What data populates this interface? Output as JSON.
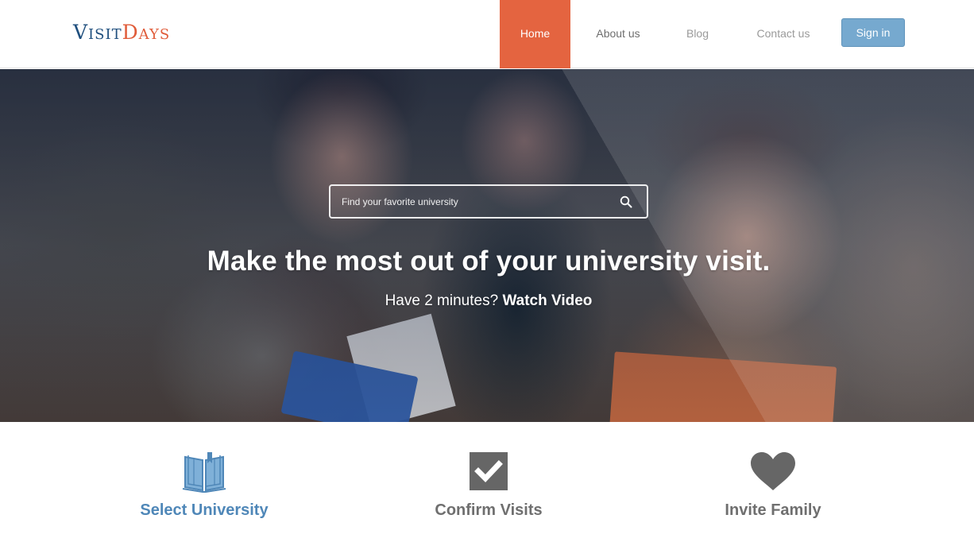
{
  "header": {
    "logo": {
      "part1": "Visit",
      "part2": "Days"
    },
    "nav": [
      {
        "label": "Home",
        "active": true
      },
      {
        "label": "About us"
      },
      {
        "label": "Blog"
      },
      {
        "label": "Contact us"
      }
    ],
    "signin_label": "Sign in"
  },
  "hero": {
    "search": {
      "placeholder": "Find your favorite university"
    },
    "headline": "Make the most out of your university visit.",
    "subtext_prefix": "Have 2 minutes? ",
    "subtext_link": "Watch Video"
  },
  "features": [
    {
      "label": "Select University",
      "icon": "open-book-icon",
      "color": "#4f87b8"
    },
    {
      "label": "Confirm Visits",
      "icon": "checkbox-icon",
      "color": "#6f6f6f"
    },
    {
      "label": "Invite Family",
      "icon": "heart-icon",
      "color": "#6f6f6f"
    }
  ],
  "colors": {
    "accent": "#e46440",
    "brand_blue": "#1f4f7e",
    "brand_orange": "#e05c3a",
    "button_blue": "#76a9cf",
    "feature_blue": "#4f87b8",
    "feature_gray": "#6f6f6f"
  }
}
